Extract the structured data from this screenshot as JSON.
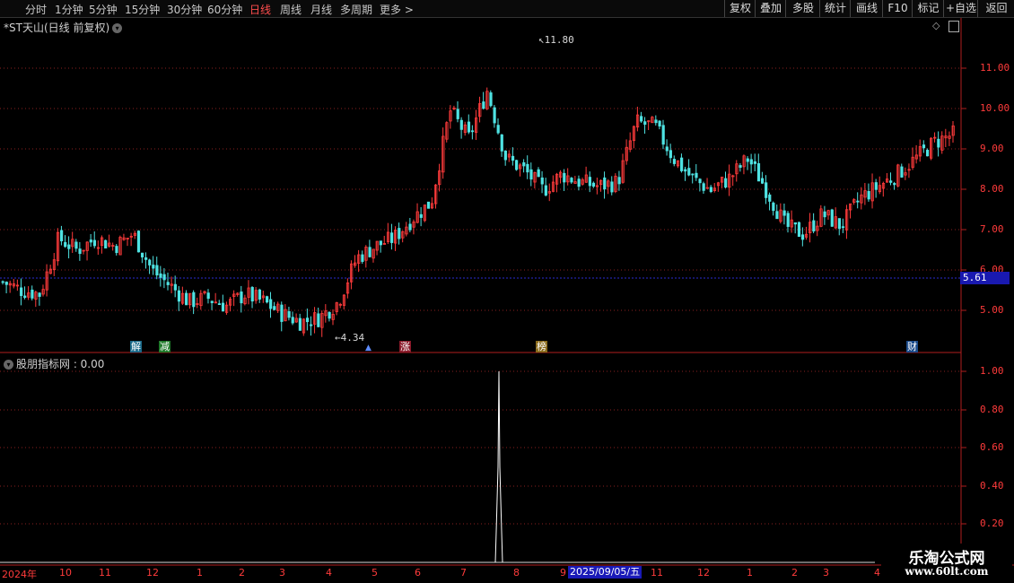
{
  "toolbar": {
    "periods": [
      "分时",
      "1分钟",
      "5分钟",
      "15分钟",
      "30分钟",
      "60分钟",
      "日线",
      "周线",
      "月线",
      "多周期",
      "更多 >"
    ],
    "active_period": "日线",
    "buttons": [
      "复权",
      "叠加",
      "多股",
      "统计",
      "画线",
      "F10",
      "标记",
      "+自选",
      "返回"
    ]
  },
  "main_chart": {
    "title": "*ST天山(日线 前复权)",
    "y_ticks": [
      "11.00",
      "10.00",
      "9.00",
      "8.00",
      "7.00",
      "6.00",
      "5.00"
    ],
    "current_price": "5.61",
    "high_label": "11.80",
    "low_label": "4.34",
    "markers": [
      "解",
      "减",
      "涨",
      "榜",
      "财"
    ]
  },
  "indicator": {
    "title": "股朋指标网 : 0.00",
    "y_ticks": [
      "1.00",
      "0.80",
      "0.60",
      "0.40",
      "0.20"
    ]
  },
  "time_axis": {
    "labels": [
      "2024年",
      "10",
      "11",
      "12",
      "1",
      "2",
      "3",
      "4",
      "5",
      "6",
      "7",
      "8",
      "9",
      "11",
      "12",
      "1",
      "2",
      "3",
      "4"
    ],
    "selected_date": "2025/09/05/五"
  },
  "watermark": {
    "line1": "乐淘公式网",
    "line2": "www.60lt.com"
  },
  "colors": {
    "up": "#ff3b3b",
    "down": "#4fe3e3",
    "background": "#000000",
    "axis": "#b01e1e",
    "highlight": "#1919b0"
  },
  "chart_data": {
    "type": "candlestick",
    "ylim": [
      4.2,
      12.2
    ],
    "x": [
      "2024年",
      "10",
      "11",
      "12",
      "1",
      "2",
      "3",
      "4",
      "5",
      "6",
      "7",
      "8",
      "9",
      "2025/09/05/五",
      "11",
      "12",
      "1",
      "2",
      "3",
      "4"
    ],
    "close_path": [
      5.9,
      5.7,
      5.6,
      7.0,
      6.7,
      7.0,
      6.8,
      7.1,
      6.2,
      5.8,
      5.4,
      5.5,
      5.3,
      5.6,
      5.4,
      5.1,
      4.9,
      5.0,
      5.4,
      6.5,
      6.8,
      7.0,
      7.5,
      7.9,
      10.2,
      9.5,
      10.7,
      9.0,
      8.7,
      8.2,
      8.6,
      8.4,
      8.3,
      8.4,
      9.9,
      9.8,
      9.0,
      8.5,
      8.2,
      8.5,
      9.0,
      8.2,
      7.3,
      7.1,
      7.6,
      7.3,
      8.0,
      8.3,
      8.6,
      9.0,
      9.4,
      9.6
    ],
    "indicator": {
      "spike_value": 1.0,
      "baseline": 0.0
    }
  }
}
